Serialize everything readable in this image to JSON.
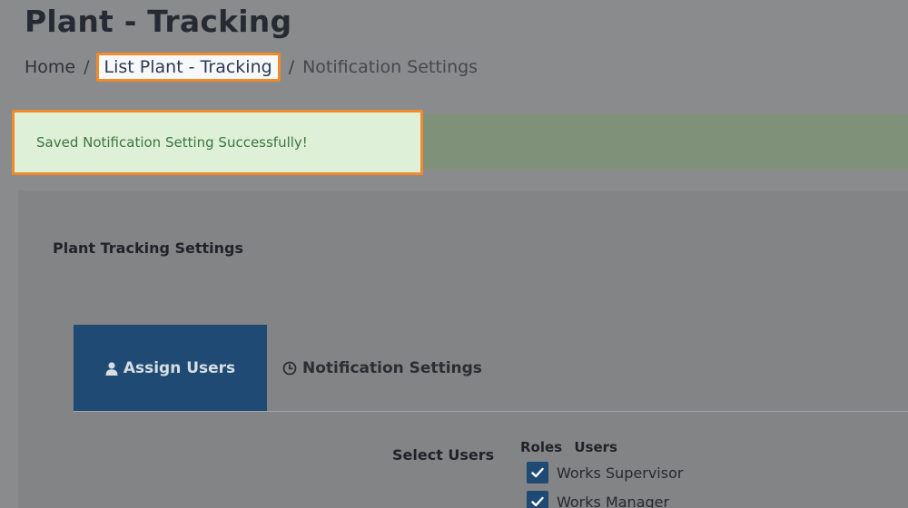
{
  "page": {
    "title": "Plant - Tracking"
  },
  "breadcrumb": {
    "home": "Home",
    "separator": "/",
    "list_link": "List Plant - Tracking",
    "current": "Notification Settings"
  },
  "alert": {
    "message": "Saved Notification Setting Successfully!",
    "status": "success"
  },
  "card": {
    "title": "Plant Tracking Settings"
  },
  "tabs": [
    {
      "label": "Assign Users",
      "icon": "user-icon",
      "active": true
    },
    {
      "label": "Notification Settings",
      "icon": "clock-icon",
      "active": false
    }
  ],
  "assign_users": {
    "select_label": "Select Users",
    "roles_header": "Roles",
    "users_header": "Users",
    "roles": [
      {
        "label": "Works Supervisor",
        "checked": true
      },
      {
        "label": "Works Manager",
        "checked": true
      }
    ]
  },
  "colors": {
    "accent": "#1e4a73",
    "highlight": "#f28a2b",
    "success_bg": "#dff0d8",
    "success_text": "#3c763d"
  }
}
